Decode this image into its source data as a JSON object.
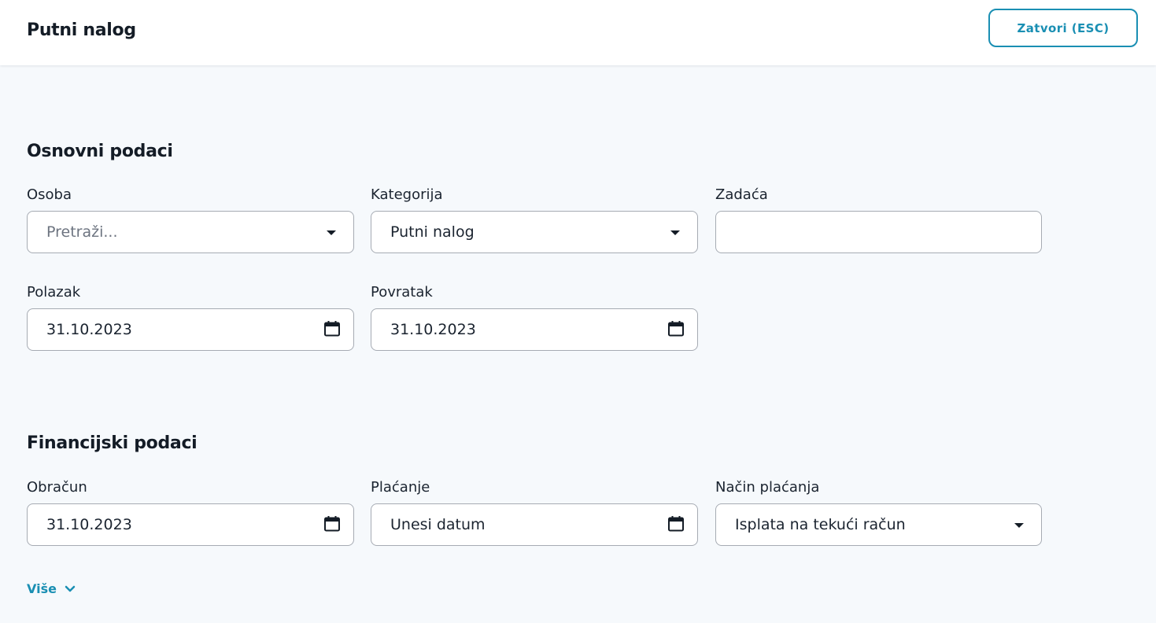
{
  "header": {
    "title": "Putni nalog",
    "close_label": "Zatvori (ESC)"
  },
  "basic": {
    "title": "Osnovni podaci",
    "person": {
      "label": "Osoba",
      "placeholder": "Pretraži..."
    },
    "category": {
      "label": "Kategorija",
      "value": "Putni nalog"
    },
    "task": {
      "label": "Zadaća",
      "value": ""
    },
    "departure": {
      "label": "Polazak",
      "value": "31.10.2023"
    },
    "return": {
      "label": "Povratak",
      "value": "31.10.2023"
    }
  },
  "financial": {
    "title": "Financijski podaci",
    "calculation": {
      "label": "Obračun",
      "value": "31.10.2023"
    },
    "payment": {
      "label": "Plaćanje",
      "placeholder": "Unesi datum"
    },
    "payment_method": {
      "label": "Način plaćanja",
      "value": "Isplata na tekući račun"
    }
  },
  "more_label": "Više",
  "colors": {
    "accent": "#1a8fb3",
    "background": "#f6f9fc",
    "border": "#a6abb3"
  },
  "icons": {
    "dropdown": "caret-down-icon",
    "date": "calendar-icon",
    "more": "chevron-down-icon"
  }
}
